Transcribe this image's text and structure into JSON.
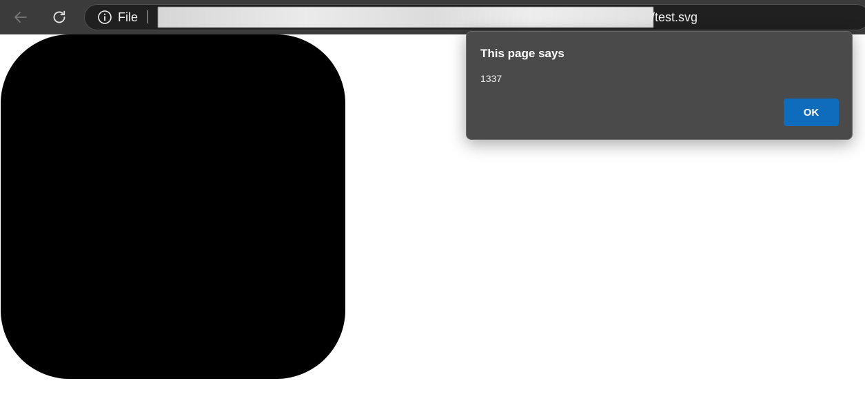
{
  "toolbar": {
    "back_icon": "back-arrow-icon",
    "reload_icon": "reload-icon",
    "address_bar": {
      "info_icon": "info-icon",
      "scheme_label": "File",
      "url_visible_tail": "/test.svg"
    }
  },
  "page": {
    "shape_color": "#000000"
  },
  "dialog": {
    "title": "This page says",
    "message": "1337",
    "ok_label": "OK",
    "ok_color": "#0f6cbd"
  }
}
